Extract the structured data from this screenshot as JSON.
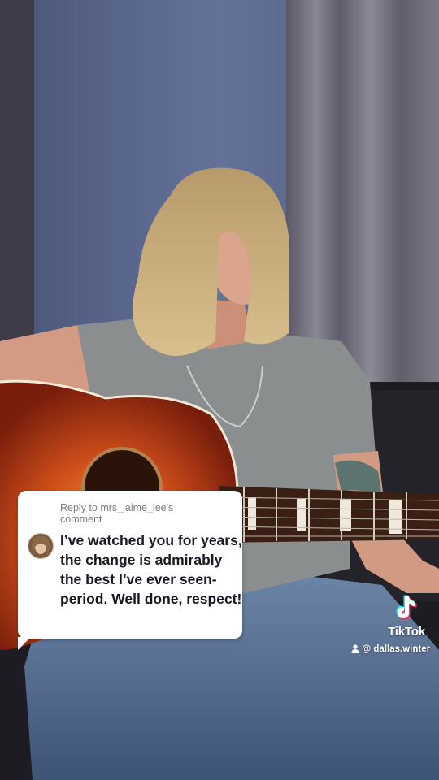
{
  "reply": {
    "header": "Reply to mrs_jaime_lee's comment",
    "comment": "I’ve watched you for years, the change is admirably the best I’ve ever seen- period. Well done, respect!"
  },
  "watermark": {
    "brand": "TikTok",
    "username": "@ dallas.winter",
    "icons": [
      "tiktok-note-icon",
      "user-icon"
    ]
  },
  "colors": {
    "card_bg": "#ffffff",
    "comment_text": "#161823",
    "header_text": "#7b7b80",
    "guitar_body": "#d2501b",
    "wall": "#5b6a8c"
  }
}
